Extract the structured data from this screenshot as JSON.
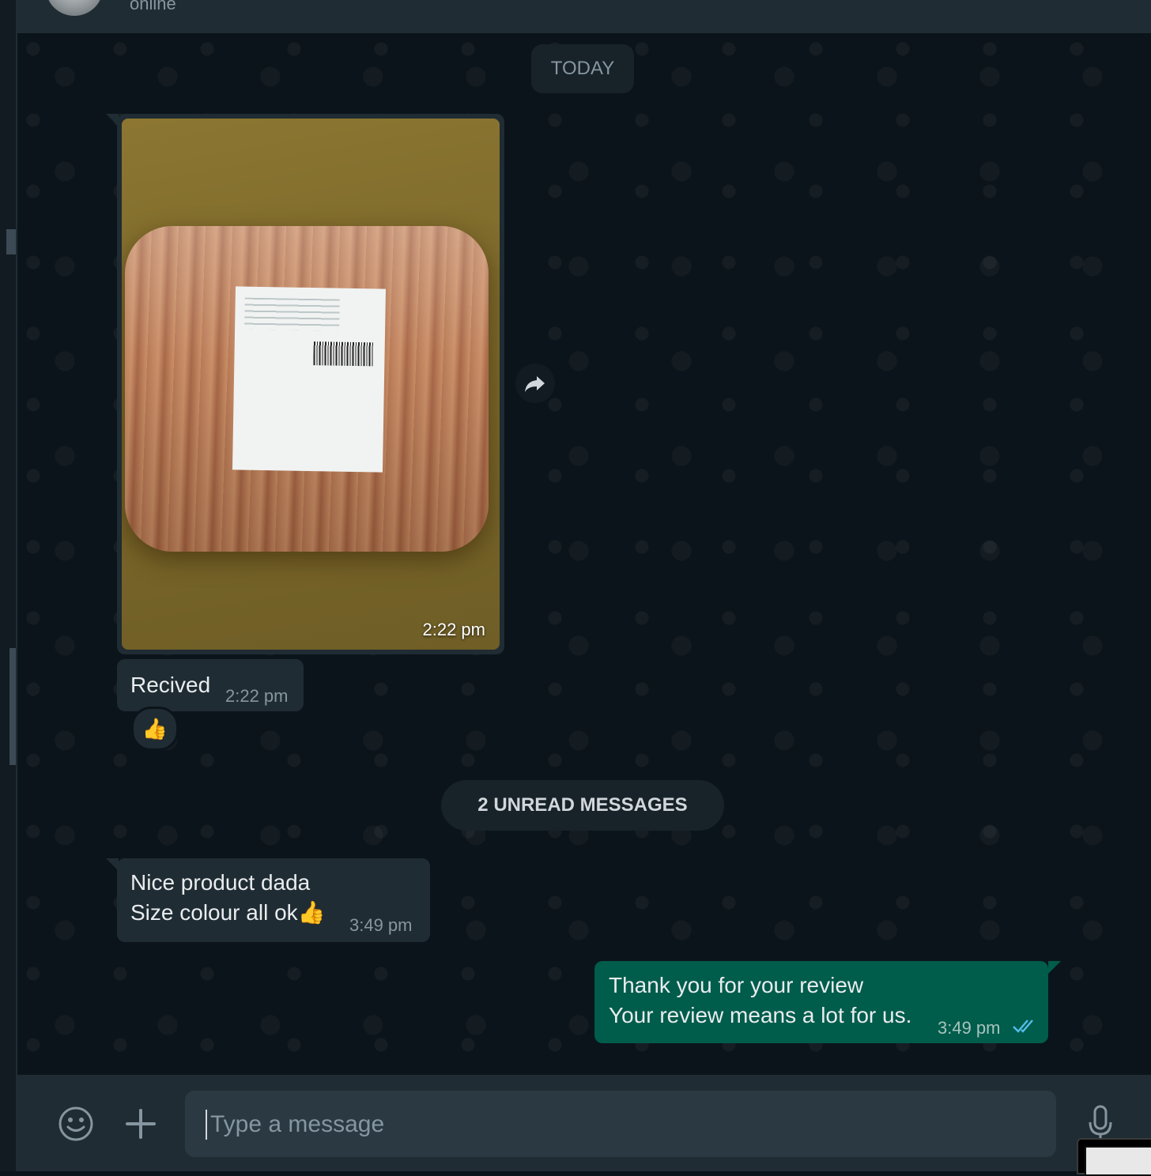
{
  "header": {
    "status": "online"
  },
  "chat": {
    "date_separator": "TODAY",
    "unread_separator": "2 UNREAD MESSAGES",
    "messages": [
      {
        "direction": "incoming",
        "type": "image",
        "time": "2:22 pm"
      },
      {
        "direction": "incoming",
        "type": "text",
        "text": "Recived",
        "time": "2:22 pm",
        "reaction": "👍"
      },
      {
        "direction": "incoming",
        "type": "text",
        "lines": [
          "Nice product dada",
          "Size colour all ok👍"
        ],
        "time": "3:49 pm"
      },
      {
        "direction": "outgoing",
        "type": "text",
        "lines": [
          "Thank you for your review",
          "Your review means a lot for us."
        ],
        "time": "3:49 pm",
        "status": "read"
      }
    ]
  },
  "composer": {
    "placeholder": "Type a message"
  },
  "icons": {
    "emoji": "smiley-icon",
    "attach": "plus-icon",
    "mic": "microphone-icon",
    "forward": "forward-icon",
    "read_receipt": "double-check-icon"
  },
  "colors": {
    "background": "#0b141a",
    "incoming_bubble": "#202c33",
    "outgoing_bubble": "#005c4b",
    "read_tick": "#53bdeb"
  }
}
